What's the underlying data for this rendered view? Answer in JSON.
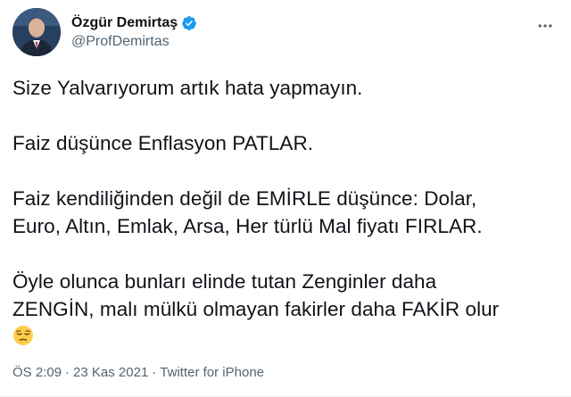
{
  "tweet": {
    "author": {
      "display_name": "Özgür Demirtaş",
      "handle": "@ProfDemirtas",
      "verified": true,
      "avatar_icon": "profile-photo",
      "verified_icon": "verified-badge-icon",
      "verified_color": "#1d9bf0"
    },
    "paragraphs": [
      "Size Yalvarıyorum artık hata yapmayın.",
      "Faiz düşünce Enflasyon PATLAR.",
      "Faiz kendiliğinden değil de EMİRLE düşünce: Dolar,\nEuro, Altın, Emlak, Arsa, Her türlü Mal fiyatı FIRLAR.",
      "Öyle olunca bunları elinde tutan Zenginler daha\nZENGİN, malı mülkü olmayan fakirler daha FAKİR olur"
    ],
    "emoji": "pensive-face",
    "meta": {
      "time": "ÖS 2:09",
      "date": "23 Kas 2021",
      "source": "Twitter for iPhone",
      "separator": "·"
    },
    "more_icon": "more-options-icon"
  }
}
